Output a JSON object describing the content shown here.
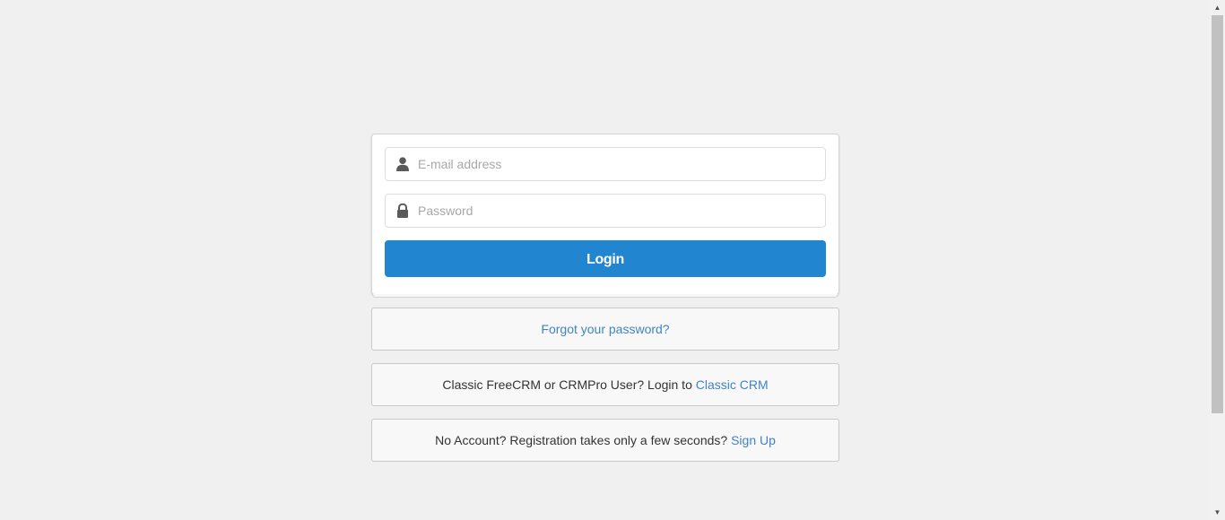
{
  "login_form": {
    "email_placeholder": "E-mail address",
    "email_value": "",
    "password_placeholder": "Password",
    "password_value": "",
    "login_label": "Login",
    "email_icon": "user-icon",
    "password_icon": "lock-icon"
  },
  "forgot": {
    "link_text": "Forgot your password?"
  },
  "classic": {
    "text": "Classic FreeCRM or CRMPro User? Login to ",
    "link_text": "Classic CRM"
  },
  "signup": {
    "text": "No Account? Registration takes only a few seconds? ",
    "link_text": "Sign Up"
  },
  "colors": {
    "background": "#f0f0f0",
    "primary_button": "#2185d0",
    "link": "#4183c4"
  },
  "scrollbar": {
    "up_arrow": "▲",
    "down_arrow": "▼"
  }
}
